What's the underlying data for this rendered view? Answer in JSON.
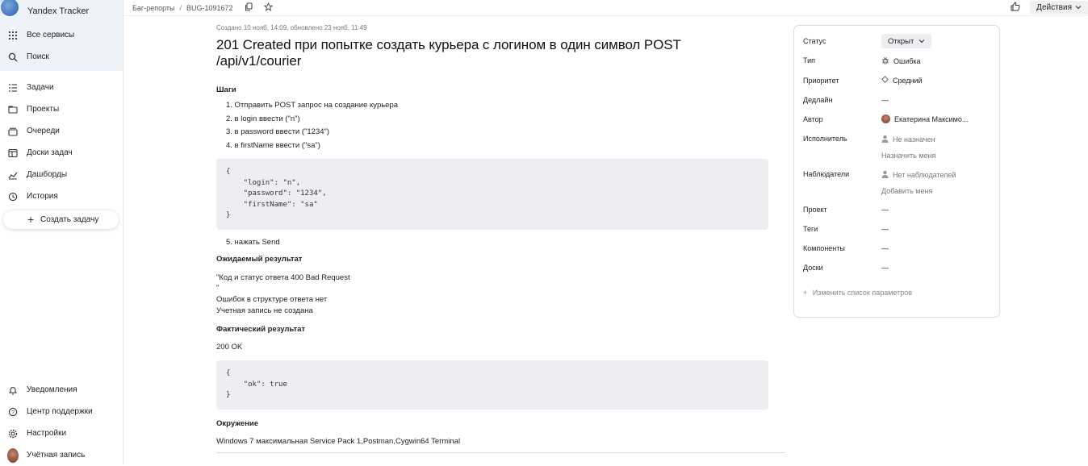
{
  "app": {
    "name": "Yandex Tracker"
  },
  "nav_top": [
    {
      "label": "Все сервисы",
      "icon": "grid-icon"
    },
    {
      "label": "Поиск",
      "icon": "search-icon"
    }
  ],
  "nav_main": [
    {
      "label": "Задачи",
      "icon": "tasks-icon"
    },
    {
      "label": "Проекты",
      "icon": "projects-icon"
    },
    {
      "label": "Очереди",
      "icon": "queues-icon"
    },
    {
      "label": "Доски задач",
      "icon": "boards-icon"
    },
    {
      "label": "Дашборды",
      "icon": "dashboards-icon"
    },
    {
      "label": "История",
      "icon": "history-icon"
    }
  ],
  "create_task": "Создать задачу",
  "nav_bottom": [
    {
      "label": "Уведомления",
      "icon": "bell-icon"
    },
    {
      "label": "Центр поддержки",
      "icon": "help-icon"
    },
    {
      "label": "Настройки",
      "icon": "gear-icon"
    },
    {
      "label": "Учётная запись",
      "icon": "avatar"
    }
  ],
  "breadcrumb": {
    "queue": "Баг-репорты",
    "separator": "/",
    "issue_key": "BUG-1091672"
  },
  "topbar": {
    "actions_label": "Действия"
  },
  "issue": {
    "meta": "Создано 10 нояб, 14:09, обновлено 23 нояб, 11:49",
    "title": "201 Created при попытке создать курьера с логином в один символ POST /api/v1/courier",
    "steps_heading": "Шаги",
    "steps": [
      "1. Отправить POST запрос на создание курьера",
      "2. в login ввести (\"n\")",
      "3. в password ввести (\"1234\")",
      "4. в firstName ввести (\"sa\")"
    ],
    "code_request": "{\n    \"login\": \"n\",\n    \"password\": \"1234\",\n    \"firstName\": \"sa\"\n}",
    "step5": "5. нажать Send",
    "expected_heading": "Ожидаемый результат",
    "expected_lines": [
      "\"Код и статус ответа 400 Bad Request",
      "\"",
      "Ошибок в структуре ответа нет",
      "Учетная запись не создана"
    ],
    "actual_heading": "Фактический результат",
    "actual_status": "200 OK",
    "code_response": "{\n    \"ok\": true\n}",
    "env_heading": "Окружение",
    "env_text": "Windows 7 максимальная Service Pack 1,Postman,Cygwin64 Terminal"
  },
  "fields": {
    "status_label": "Статус",
    "status_value": "Открыт",
    "type_label": "Тип",
    "type_value": "Ошибка",
    "priority_label": "Приоритет",
    "priority_value": "Средний",
    "deadline_label": "Дедлайн",
    "deadline_value": "—",
    "author_label": "Автор",
    "author_value": "Екатерина Максимо...",
    "assignee_label": "Исполнитель",
    "assignee_value": "Не назначен",
    "assign_me": "Назначить меня",
    "followers_label": "Наблюдатели",
    "followers_value": "Нет наблюдателей",
    "add_me": "Добавить меня",
    "project_label": "Проект",
    "project_value": "—",
    "tags_label": "Теги",
    "tags_value": "—",
    "components_label": "Компоненты",
    "components_value": "—",
    "boards_label": "Доски",
    "boards_value": "—",
    "change_params": "Изменить список параметров"
  }
}
